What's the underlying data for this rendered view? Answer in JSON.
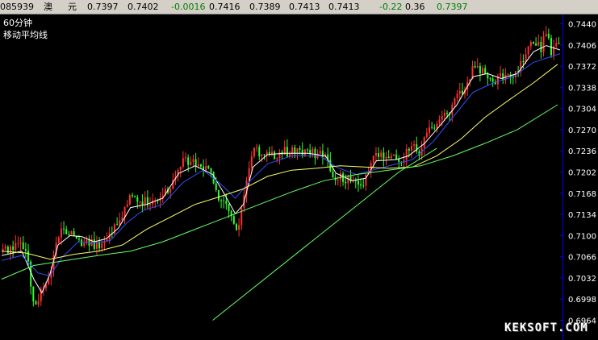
{
  "quote_bar": {
    "code": "085939",
    "name1": "澳",
    "name2": "元",
    "open": "0.7397",
    "high": "0.7402",
    "change": "-0.0016",
    "v1": "0.7416",
    "v2": "0.7389",
    "v3": "0.7413",
    "v4": "0.7413",
    "pct": "-0.22",
    "v5": "0.36",
    "last": "0.7397"
  },
  "panel": {
    "period": "60分钟",
    "indicator": "移动平均线"
  },
  "watermark": "KEKSOFT.COM",
  "colors": {
    "background": "#000000",
    "axis": "#0000ff",
    "up_candle": "#ff3030",
    "down_candle": "#30ff30",
    "ma_fast": "#ffffff",
    "ma_mid": "#3050ff",
    "ma_slow": "#ffff66",
    "ma_long": "#66ff66",
    "trendline": "#66ff66"
  },
  "chart_data": {
    "type": "line",
    "title": "",
    "xlabel": "",
    "ylabel": "",
    "ylim": [
      0.6964,
      0.744
    ],
    "y_ticks": [
      "0.7440",
      "0.7406",
      "0.7372",
      "0.7338",
      "0.7304",
      "0.7270",
      "0.7236",
      "0.7202",
      "0.7168",
      "0.7134",
      "0.7100",
      "0.7066",
      "0.7032",
      "0.6998",
      "0.6964"
    ],
    "grid": false,
    "candles_approx": {
      "count": 220,
      "close_path": [
        [
          0,
          0.7075
        ],
        [
          12,
          0.7082
        ],
        [
          22,
          0.7088
        ],
        [
          30,
          0.707
        ],
        [
          34,
          0.7045
        ],
        [
          38,
          0.6998
        ],
        [
          42,
          0.6985
        ],
        [
          48,
          0.701
        ],
        [
          55,
          0.702
        ],
        [
          60,
          0.704
        ],
        [
          64,
          0.7055
        ],
        [
          68,
          0.7095
        ],
        [
          75,
          0.7105
        ],
        [
          85,
          0.7108
        ],
        [
          95,
          0.7092
        ],
        [
          105,
          0.709
        ],
        [
          115,
          0.7085
        ],
        [
          120,
          0.7082
        ],
        [
          125,
          0.709
        ],
        [
          130,
          0.71
        ],
        [
          138,
          0.7112
        ],
        [
          148,
          0.712
        ],
        [
          155,
          0.7152
        ],
        [
          160,
          0.716
        ],
        [
          170,
          0.715
        ],
        [
          180,
          0.7155
        ],
        [
          190,
          0.715
        ],
        [
          200,
          0.7165
        ],
        [
          210,
          0.7175
        ],
        [
          215,
          0.7195
        ],
        [
          222,
          0.7215
        ],
        [
          230,
          0.722
        ],
        [
          240,
          0.7215
        ],
        [
          248,
          0.7205
        ],
        [
          255,
          0.721
        ],
        [
          262,
          0.7195
        ],
        [
          270,
          0.716
        ],
        [
          278,
          0.7145
        ],
        [
          285,
          0.713
        ],
        [
          290,
          0.7105
        ],
        [
          295,
          0.7125
        ],
        [
          300,
          0.716
        ],
        [
          306,
          0.7205
        ],
        [
          312,
          0.724
        ],
        [
          320,
          0.7235
        ],
        [
          330,
          0.723
        ],
        [
          340,
          0.7225
        ],
        [
          350,
          0.724
        ],
        [
          355,
          0.723
        ],
        [
          362,
          0.7235
        ],
        [
          372,
          0.7232
        ],
        [
          382,
          0.7235
        ],
        [
          392,
          0.7228
        ],
        [
          402,
          0.7232
        ],
        [
          408,
          0.721
        ],
        [
          415,
          0.718
        ],
        [
          422,
          0.7195
        ],
        [
          430,
          0.719
        ],
        [
          440,
          0.7185
        ],
        [
          447,
          0.718
        ],
        [
          455,
          0.7205
        ],
        [
          462,
          0.7235
        ],
        [
          470,
          0.723
        ],
        [
          480,
          0.7228
        ],
        [
          490,
          0.7222
        ],
        [
          497,
          0.7215
        ],
        [
          503,
          0.7235
        ],
        [
          510,
          0.724
        ],
        [
          518,
          0.7235
        ],
        [
          525,
          0.7255
        ],
        [
          535,
          0.7275
        ],
        [
          545,
          0.7285
        ],
        [
          555,
          0.73
        ],
        [
          565,
          0.732
        ],
        [
          575,
          0.734
        ],
        [
          585,
          0.737
        ],
        [
          595,
          0.7365
        ],
        [
          603,
          0.736
        ],
        [
          610,
          0.7345
        ],
        [
          620,
          0.7355
        ],
        [
          630,
          0.7352
        ],
        [
          640,
          0.7362
        ],
        [
          650,
          0.7395
        ],
        [
          660,
          0.741
        ],
        [
          670,
          0.74
        ],
        [
          676,
          0.743
        ],
        [
          682,
          0.739
        ],
        [
          688,
          0.7405
        ],
        [
          693,
          0.7397
        ]
      ],
      "noise": 0.0016,
      "seed": 20150711
    },
    "series": [
      {
        "path": [
          [
            0,
            0.7068
          ],
          [
            25,
            0.7075
          ],
          [
            40,
            0.703
          ],
          [
            50,
            0.7008
          ],
          [
            60,
            0.7038
          ],
          [
            70,
            0.7085
          ],
          [
            85,
            0.71
          ],
          [
            100,
            0.7098
          ],
          [
            115,
            0.709
          ],
          [
            130,
            0.7095
          ],
          [
            145,
            0.7112
          ],
          [
            160,
            0.7145
          ],
          [
            180,
            0.715
          ],
          [
            200,
            0.716
          ],
          [
            220,
            0.72
          ],
          [
            240,
            0.7212
          ],
          [
            262,
            0.7198
          ],
          [
            275,
            0.717
          ],
          [
            290,
            0.7135
          ],
          [
            300,
            0.715
          ],
          [
            312,
            0.721
          ],
          [
            330,
            0.723
          ],
          [
            350,
            0.7232
          ],
          [
            380,
            0.7232
          ],
          [
            402,
            0.7228
          ],
          [
            415,
            0.72
          ],
          [
            435,
            0.7188
          ],
          [
            452,
            0.7192
          ],
          [
            465,
            0.722
          ],
          [
            490,
            0.7222
          ],
          [
            505,
            0.7228
          ],
          [
            525,
            0.7248
          ],
          [
            545,
            0.7278
          ],
          [
            565,
            0.731
          ],
          [
            585,
            0.7355
          ],
          [
            603,
            0.736
          ],
          [
            620,
            0.7352
          ],
          [
            640,
            0.736
          ],
          [
            660,
            0.7395
          ],
          [
            676,
            0.7405
          ],
          [
            693,
            0.7398
          ]
        ]
      },
      {
        "path": [
          [
            0,
            0.706
          ],
          [
            25,
            0.7068
          ],
          [
            45,
            0.704
          ],
          [
            60,
            0.7035
          ],
          [
            75,
            0.7065
          ],
          [
            95,
            0.709
          ],
          [
            115,
            0.7088
          ],
          [
            135,
            0.7092
          ],
          [
            155,
            0.712
          ],
          [
            175,
            0.714
          ],
          [
            200,
            0.715
          ],
          [
            225,
            0.7185
          ],
          [
            250,
            0.7205
          ],
          [
            270,
            0.7185
          ],
          [
            290,
            0.716
          ],
          [
            310,
            0.719
          ],
          [
            330,
            0.7215
          ],
          [
            360,
            0.7228
          ],
          [
            395,
            0.7228
          ],
          [
            415,
            0.721
          ],
          [
            440,
            0.7198
          ],
          [
            460,
            0.7205
          ],
          [
            490,
            0.7215
          ],
          [
            510,
            0.7222
          ],
          [
            535,
            0.725
          ],
          [
            560,
            0.729
          ],
          [
            585,
            0.733
          ],
          [
            610,
            0.7345
          ],
          [
            635,
            0.7355
          ],
          [
            660,
            0.7378
          ],
          [
            693,
            0.7392
          ]
        ]
      },
      {
        "path": [
          [
            0,
            0.7075
          ],
          [
            30,
            0.7072
          ],
          [
            60,
            0.7062
          ],
          [
            90,
            0.707
          ],
          [
            120,
            0.7075
          ],
          [
            150,
            0.7085
          ],
          [
            180,
            0.711
          ],
          [
            210,
            0.713
          ],
          [
            240,
            0.715
          ],
          [
            270,
            0.7162
          ],
          [
            300,
            0.7175
          ],
          [
            330,
            0.7195
          ],
          [
            360,
            0.7205
          ],
          [
            390,
            0.7208
          ],
          [
            420,
            0.7212
          ],
          [
            450,
            0.721
          ],
          [
            480,
            0.7208
          ],
          [
            510,
            0.721
          ],
          [
            540,
            0.7228
          ],
          [
            570,
            0.7255
          ],
          [
            600,
            0.729
          ],
          [
            630,
            0.7318
          ],
          [
            660,
            0.7345
          ],
          [
            690,
            0.7375
          ]
        ]
      },
      {
        "path": [
          [
            0,
            0.703
          ],
          [
            40,
            0.7052
          ],
          [
            80,
            0.706
          ],
          [
            120,
            0.7068
          ],
          [
            160,
            0.7075
          ],
          [
            200,
            0.709
          ],
          [
            240,
            0.711
          ],
          [
            280,
            0.713
          ],
          [
            320,
            0.715
          ],
          [
            360,
            0.717
          ],
          [
            400,
            0.7188
          ],
          [
            440,
            0.7198
          ],
          [
            480,
            0.7205
          ],
          [
            520,
            0.7212
          ],
          [
            560,
            0.7228
          ],
          [
            600,
            0.7248
          ],
          [
            640,
            0.727
          ],
          [
            690,
            0.731
          ]
        ]
      },
      {
        "path": [
          [
            262,
            0.6964
          ],
          [
            493,
            0.7202
          ],
          [
            540,
            0.724
          ]
        ]
      }
    ]
  }
}
